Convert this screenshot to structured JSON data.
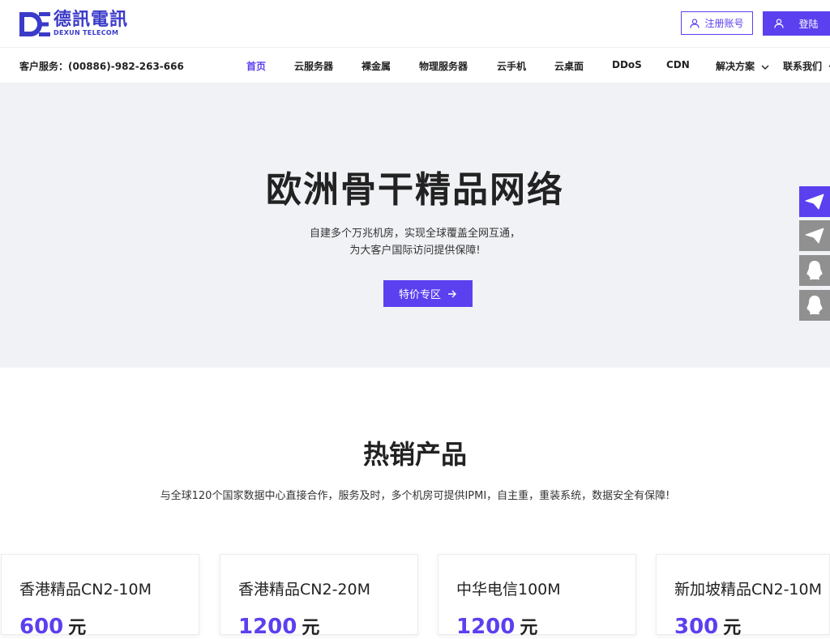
{
  "brand": {
    "name_cn": "德訊電訊",
    "name_en": "DEXUN TELECOM",
    "accent": "#5b40f0"
  },
  "header": {
    "register_label": "注册账号",
    "login_label": "登陆",
    "service_label": "客户服务：",
    "service_phone": "(00886)-982-263-666"
  },
  "nav": {
    "items": [
      {
        "label": "首页",
        "active": true
      },
      {
        "label": "云服务器"
      },
      {
        "label": "裸金属"
      },
      {
        "label": "物理服务器"
      },
      {
        "label": "云手机"
      },
      {
        "label": "云桌面"
      },
      {
        "label": "DDoS"
      },
      {
        "label": "CDN"
      },
      {
        "label": "解决方案",
        "dropdown": true
      },
      {
        "label": "联系我们",
        "dropdown": true
      }
    ]
  },
  "hero": {
    "title": "欧洲骨干精品网络",
    "subtitle_line1": "自建多个万兆机房，实现全球覆盖全网互通，",
    "subtitle_line2": "为大客户国际访问提供保障!",
    "button_label": "特价专区",
    "background": "#f0f2f5"
  },
  "side_buttons": [
    {
      "icon": "paper-plane-icon",
      "color": "#5b40f0"
    },
    {
      "icon": "paper-plane-icon",
      "color": "#909090"
    },
    {
      "icon": "qq-penguin-icon",
      "color": "#909090"
    },
    {
      "icon": "qq-penguin-icon",
      "color": "#909090"
    }
  ],
  "products": {
    "title": "热销产品",
    "subtitle": "与全球120个国家数据中心直接合作，服务及时，多个机房可提供IPMI，自主重，重装系统，数据安全有保障!",
    "cards": [
      {
        "name": "香港精品CN2-10M",
        "price": "600",
        "unit": "元"
      },
      {
        "name": "香港精品CN2-20M",
        "price": "1200",
        "unit": "元"
      },
      {
        "name": "中华电信100M",
        "price": "1200",
        "unit": "元"
      },
      {
        "name": "新加坡精品CN2-10M",
        "price": "300",
        "unit": "元"
      }
    ]
  }
}
